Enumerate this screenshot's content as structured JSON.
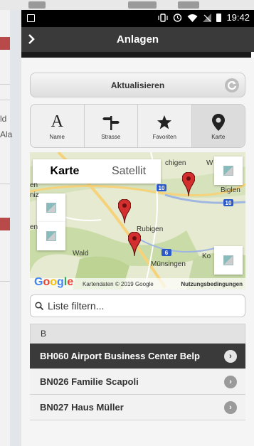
{
  "status": {
    "time": "19:42"
  },
  "titlebar": {
    "title": "Anlagen"
  },
  "toolbar": {
    "refresh_label": "Aktualisieren"
  },
  "tabs": [
    {
      "label": "Name",
      "icon": "letter-a-icon"
    },
    {
      "label": "Strasse",
      "icon": "signpost-icon"
    },
    {
      "label": "Favoriten",
      "icon": "star-icon"
    },
    {
      "label": "Karte",
      "icon": "map-marker-icon",
      "selected": true
    }
  ],
  "map": {
    "type_buttons": [
      {
        "label": "Karte",
        "selected": true
      },
      {
        "label": "Satellit",
        "selected": false
      }
    ],
    "places": [
      "chigen",
      "W",
      "Biglen",
      "Rubigen",
      "Wald",
      "Münsingen",
      "Ko",
      "en",
      "en",
      "niz"
    ],
    "road_numbers": [
      "10",
      "10",
      "6"
    ],
    "logo": "Google",
    "data_credit": "Kartendaten © 2019 Google",
    "terms": "Nutzungsbedingungen"
  },
  "filter": {
    "placeholder": "Liste filtern..."
  },
  "list": {
    "divider": "B",
    "items": [
      {
        "label": "BH060 Airport Business Center Belp",
        "active": true
      },
      {
        "label": "BN026 Familie Scapoli",
        "active": false
      },
      {
        "label": "BN027 Haus Müller",
        "active": false
      }
    ]
  },
  "background_app": {
    "texts": [
      "ld",
      "Ala"
    ]
  }
}
